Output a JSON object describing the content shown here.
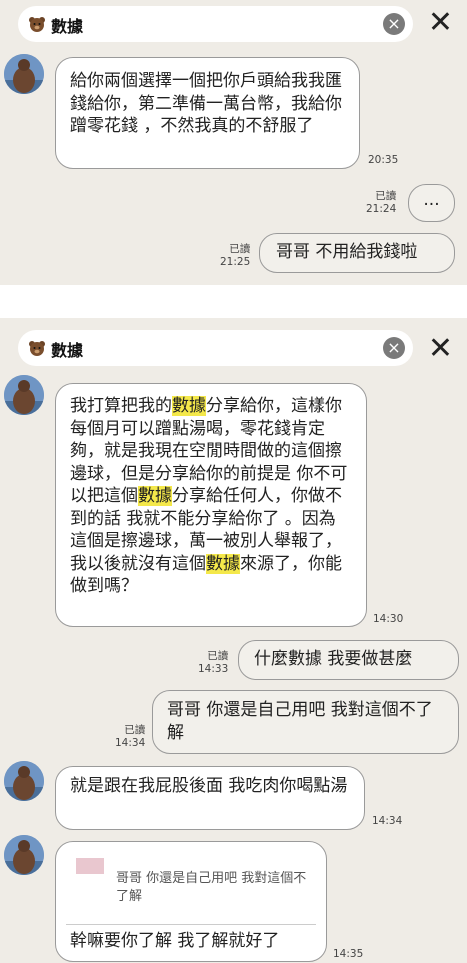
{
  "panel1": {
    "search_query": "數據",
    "messages": [
      {
        "text": "給你兩個選擇一個把你戶頭給我我匯錢給你，第二準備一萬台幣，我給你蹭零花錢 ，不然我真的不舒服了",
        "time": "20:35"
      },
      {
        "text": "...",
        "read": "已讀",
        "time": "21:24"
      },
      {
        "text": "哥哥 不用給我錢啦",
        "read": "已讀",
        "time": "21:25"
      }
    ]
  },
  "panel2": {
    "search_query": "數據",
    "highlight_term": "數據",
    "messages": [
      {
        "parts": [
          "我打算把我的",
          "數據",
          "分享給你，這樣你每個月可以蹭點湯喝，零花錢肯定夠，就是我現在空閒時間做的這個擦邊球，但是分享給你的前提是 你不可以把這個",
          "數據",
          "分享給任何人，你做不到的話 我就不能分享給你了 。因為這個是擦邊球，萬一被別人舉報了，我以後就沒有這個",
          "數據",
          "來源了，你能做到嗎？"
        ],
        "time": "14:30"
      },
      {
        "text": "什麼數據 我要做甚麼",
        "read": "已讀",
        "time": "14:33"
      },
      {
        "text": "哥哥 你還是自己用吧 我對這個不了解",
        "read": "已讀",
        "time": "14:34"
      },
      {
        "text": "就是跟在我屁股後面 我吃肉你喝點湯",
        "time": "14:34"
      },
      {
        "quote": "哥哥 你還是自己用吧 我對這個不了解",
        "text": "幹嘛要你了解 我了解就好了",
        "time": "14:35"
      }
    ]
  },
  "colors": {
    "background": "#efece6",
    "bubble_border": "#9a9a9a",
    "highlight": "#f4e84a"
  }
}
